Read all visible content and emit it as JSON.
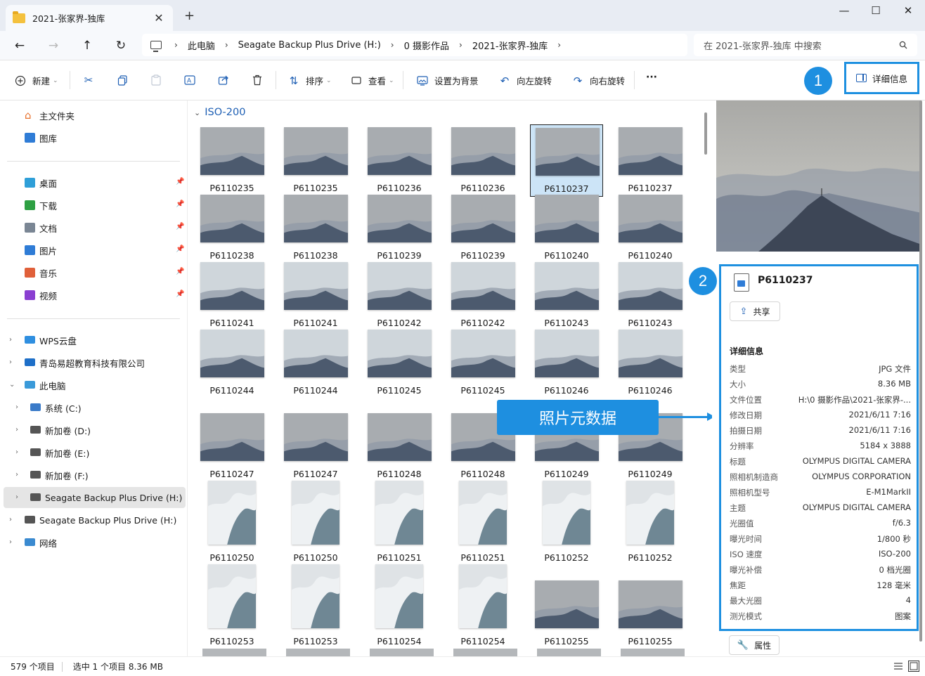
{
  "window": {
    "tab_title": "2021-张家界-独库",
    "tab_close": "✕",
    "new_tab": "+",
    "minimize": "—",
    "maximize": "☐",
    "close": "✕"
  },
  "address": {
    "crumbs": [
      "此电脑",
      "Seagate Backup Plus Drive (H:)",
      "0 摄影作品",
      "2021-张家界-独库"
    ],
    "search_placeholder": "在 2021-张家界-独库 中搜索"
  },
  "toolbar": {
    "new_label": "新建",
    "sort_label": "排序",
    "view_label": "查看",
    "set_background_label": "设置为背景",
    "rotate_left_label": "向左旋转",
    "rotate_right_label": "向右旋转",
    "more_label": "···",
    "details_label": "详细信息"
  },
  "markers": {
    "one": "1",
    "two": "2"
  },
  "sidebar": {
    "home": "主文件夹",
    "gallery": "图库",
    "quick": [
      {
        "label": "桌面",
        "color": "#2f9fd8"
      },
      {
        "label": "下载",
        "color": "#2ea043"
      },
      {
        "label": "文档",
        "color": "#7a8694"
      },
      {
        "label": "图片",
        "color": "#2f7cd6"
      },
      {
        "label": "音乐",
        "color": "#e0603a"
      },
      {
        "label": "视频",
        "color": "#8a3fd1"
      }
    ],
    "tree": [
      {
        "label": "WPS云盘",
        "color": "#2f8fe0",
        "expand": "›"
      },
      {
        "label": "青岛易超教育科技有限公司",
        "color": "#1e6fc8",
        "expand": "›"
      },
      {
        "label": "此电脑",
        "color": "#3a9ad9",
        "expand": "⌄"
      },
      {
        "label": "系统 (C:)",
        "color": "#3a7ac8",
        "expand": "›"
      },
      {
        "label": "新加卷 (D:)",
        "color": "#555555",
        "expand": "›"
      },
      {
        "label": "新加卷 (E:)",
        "color": "#555555",
        "expand": "›"
      },
      {
        "label": "新加卷 (F:)",
        "color": "#555555",
        "expand": "›"
      },
      {
        "label": "Seagate Backup Plus Drive (H:)",
        "color": "#555555",
        "expand": "›"
      },
      {
        "label": "Seagate Backup Plus Drive (H:)",
        "color": "#555555",
        "expand": "›"
      },
      {
        "label": "网络",
        "color": "#3a8ad0",
        "expand": "›"
      }
    ]
  },
  "group": {
    "name": "ISO-200"
  },
  "files": [
    "P6110235",
    "P6110235",
    "P6110236",
    "P6110236",
    "P6110237",
    "P6110237",
    "P6110238",
    "P6110238",
    "P6110239",
    "P6110239",
    "P6110240",
    "P6110240",
    "P6110241",
    "P6110241",
    "P6110242",
    "P6110242",
    "P6110243",
    "P6110243",
    "P6110244",
    "P6110244",
    "P6110245",
    "P6110245",
    "P6110246",
    "P6110246",
    "P6110247",
    "P6110247",
    "P6110248",
    "P6110248",
    "P6110249",
    "P6110249",
    "P6110250",
    "P6110250",
    "P6110251",
    "P6110251",
    "P6110252",
    "P6110252",
    "P6110253",
    "P6110253",
    "P6110254",
    "P6110254",
    "P6110255",
    "P6110255"
  ],
  "callout": {
    "label": "照片元数据"
  },
  "details": {
    "file_name": "P6110237",
    "share_label": "共享",
    "section_title": "详细信息",
    "rows": [
      {
        "k": "类型",
        "v": "JPG 文件"
      },
      {
        "k": "大小",
        "v": "8.36 MB"
      },
      {
        "k": "文件位置",
        "v": "H:\\0 摄影作品\\2021-张家界-..."
      },
      {
        "k": "修改日期",
        "v": "2021/6/11 7:16"
      },
      {
        "k": "拍摄日期",
        "v": "2021/6/11 7:16"
      },
      {
        "k": "分辨率",
        "v": "5184 x 3888"
      },
      {
        "k": "标题",
        "v": "OLYMPUS DIGITAL CAMERA"
      },
      {
        "k": "照相机制造商",
        "v": "OLYMPUS CORPORATION"
      },
      {
        "k": "照相机型号",
        "v": "E-M1MarkII"
      },
      {
        "k": "主题",
        "v": "OLYMPUS DIGITAL CAMERA"
      },
      {
        "k": "光圈值",
        "v": "f/6.3"
      },
      {
        "k": "曝光时间",
        "v": "1/800 秒"
      },
      {
        "k": "ISO 速度",
        "v": "ISO-200"
      },
      {
        "k": "曝光补偿",
        "v": "0 档光圈"
      },
      {
        "k": "焦距",
        "v": "128 毫米"
      },
      {
        "k": "最大光圈",
        "v": "4"
      },
      {
        "k": "测光模式",
        "v": "图案"
      }
    ],
    "properties_label": "属性"
  },
  "status": {
    "count": "579 个项目",
    "selection": "选中 1 个项目  8.36 MB"
  }
}
